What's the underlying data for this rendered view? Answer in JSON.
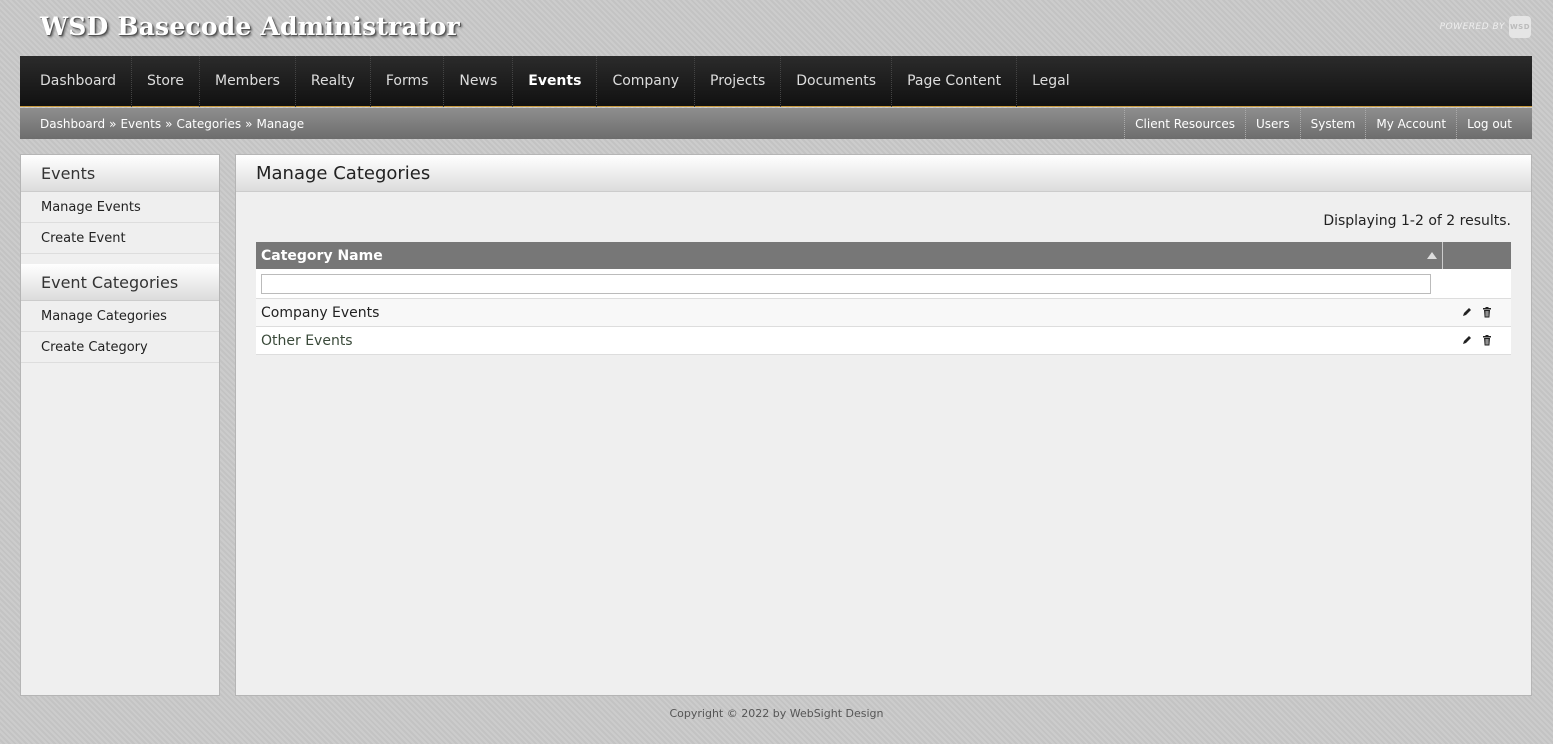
{
  "header": {
    "title": "WSD Basecode Administrator",
    "powered_by": "POWERED BY",
    "badge": "WSD"
  },
  "main_nav": {
    "items": [
      {
        "label": "Dashboard",
        "active": false
      },
      {
        "label": "Store",
        "active": false
      },
      {
        "label": "Members",
        "active": false
      },
      {
        "label": "Realty",
        "active": false
      },
      {
        "label": "Forms",
        "active": false
      },
      {
        "label": "News",
        "active": false
      },
      {
        "label": "Events",
        "active": true
      },
      {
        "label": "Company",
        "active": false
      },
      {
        "label": "Projects",
        "active": false
      },
      {
        "label": "Documents",
        "active": false
      },
      {
        "label": "Page Content",
        "active": false
      },
      {
        "label": "Legal",
        "active": false
      }
    ]
  },
  "breadcrumb": {
    "items": [
      "Dashboard",
      "Events",
      "Categories",
      "Manage"
    ],
    "separator": "»"
  },
  "util_nav": {
    "items": [
      "Client Resources",
      "Users",
      "System",
      "My Account",
      "Log out"
    ]
  },
  "sidebar": {
    "sections": [
      {
        "heading": "Events",
        "links": [
          "Manage Events",
          "Create Event"
        ]
      },
      {
        "heading": "Event Categories",
        "links": [
          "Manage Categories",
          "Create Category"
        ]
      }
    ]
  },
  "main": {
    "title": "Manage Categories",
    "summary": "Displaying 1-2 of 2 results.",
    "table": {
      "columns": [
        "Category Name",
        ""
      ],
      "filter_value": "",
      "rows": [
        {
          "name": "Company Events"
        },
        {
          "name": "Other Events"
        }
      ]
    }
  },
  "footer": {
    "text": "Copyright © 2022 by WebSight Design"
  },
  "colors": {
    "nav_bg": "#1a1a1a",
    "nav_accent": "#c89a3e",
    "subbar_bg": "#7d7d7d",
    "table_header_bg": "#777777"
  }
}
